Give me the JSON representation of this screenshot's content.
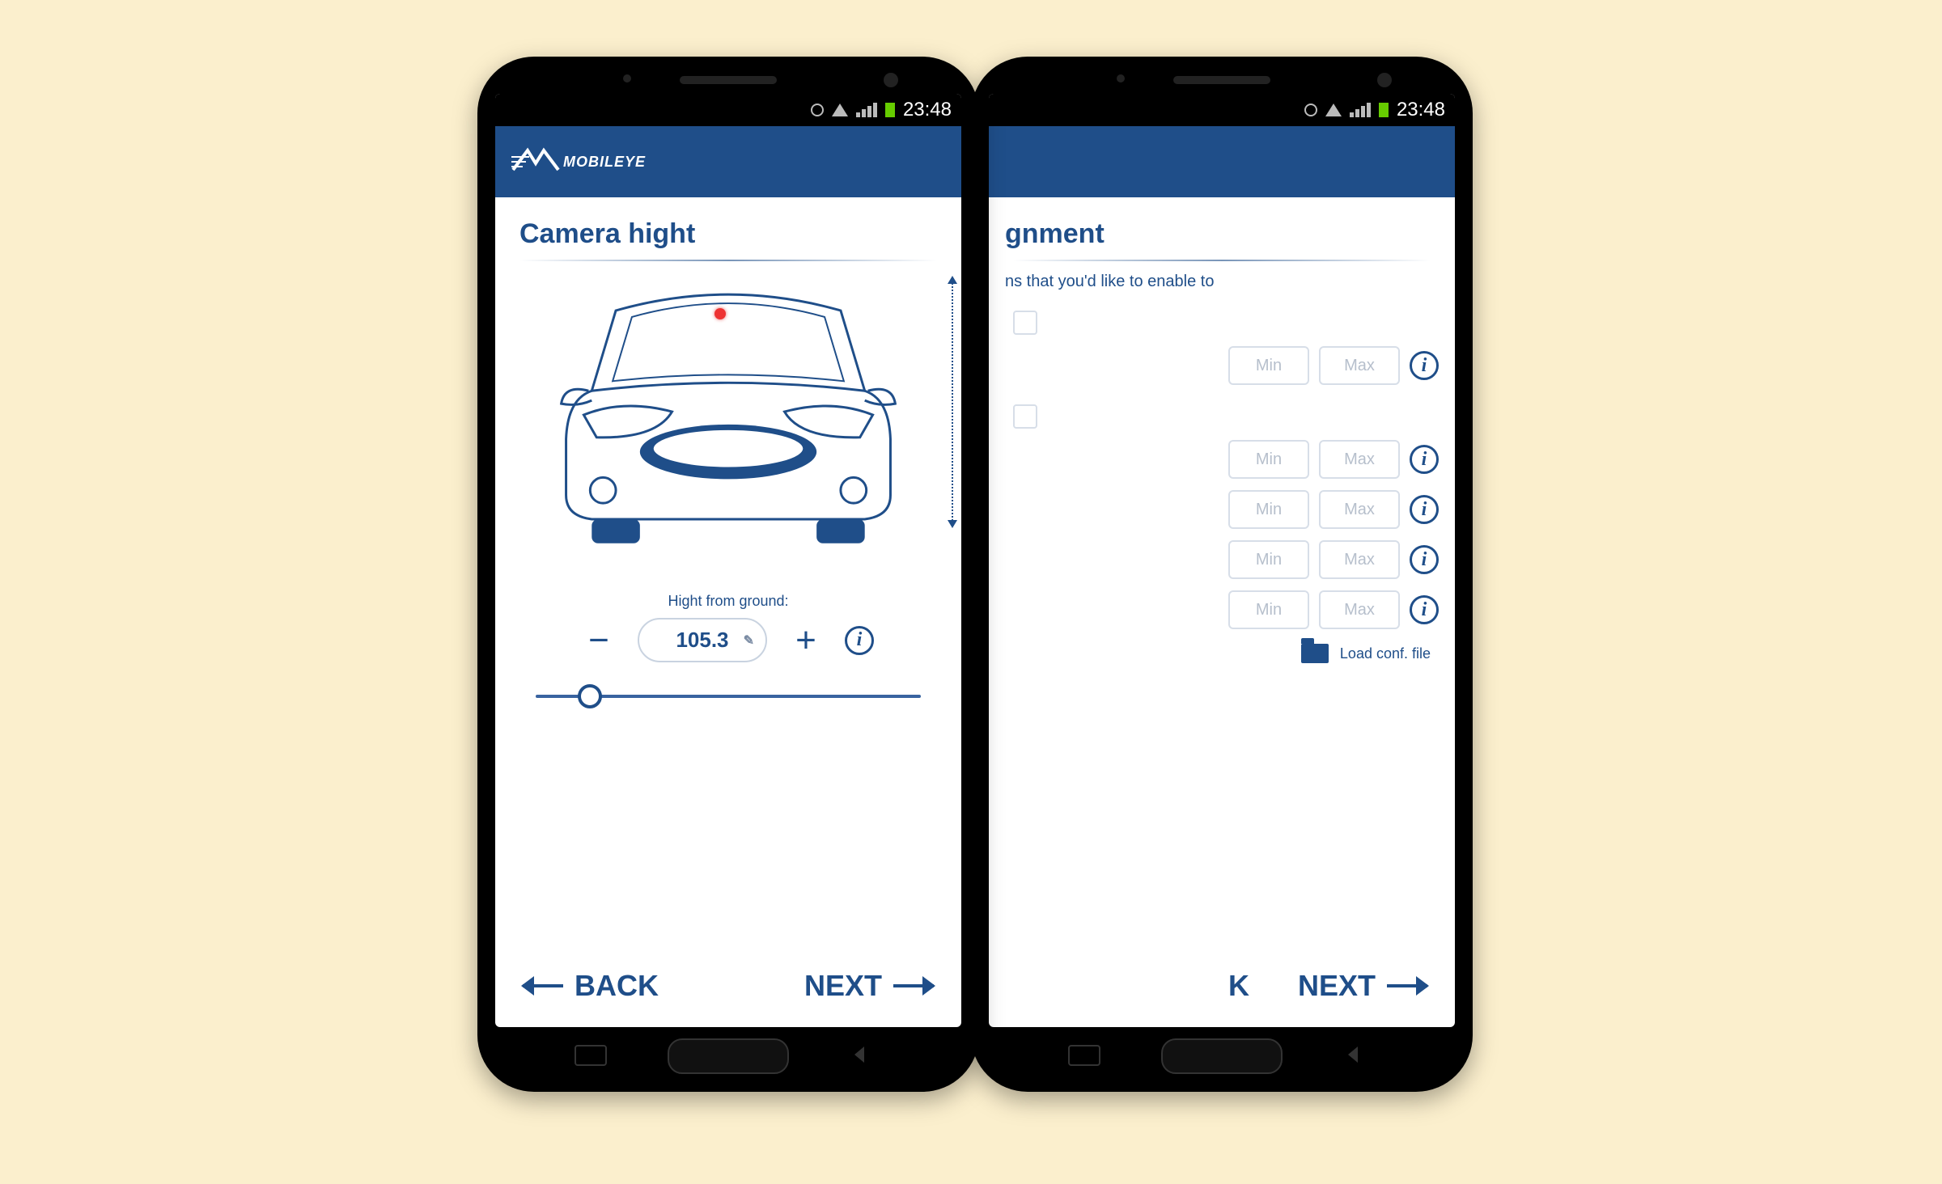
{
  "status": {
    "time": "23:48"
  },
  "brand": "MOBILEYE",
  "left": {
    "title": "Camera hight",
    "hight_label": "Hight from ground:",
    "hight_value": "105.3",
    "back": "BACK",
    "next": "NEXT"
  },
  "right": {
    "title_partial": "gnment",
    "subtext_partial": "ns that you'd like to enable to",
    "min": "Min",
    "max": "Max",
    "load_conf": "Load conf. file",
    "back_partial": "K",
    "next": "NEXT"
  }
}
